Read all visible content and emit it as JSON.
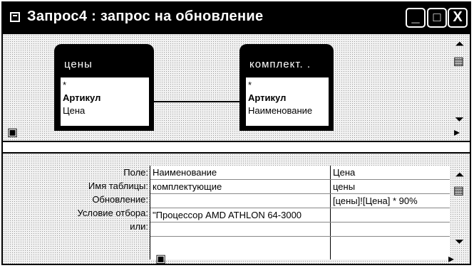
{
  "window": {
    "title": "Запрос4 : запрос на обновление",
    "controls": {
      "minimize": "_",
      "maximize": "□",
      "close": "X"
    }
  },
  "tables": [
    {
      "title": "цены",
      "fields": [
        "*",
        "Артикул",
        "Цена"
      ]
    },
    {
      "title": "комплект. .",
      "fields": [
        "*",
        "Артикул",
        "Наименование"
      ]
    }
  ],
  "grid": {
    "row_labels": [
      "Поле:",
      "Имя таблицы:",
      "Обновление:",
      "Условие отбора:",
      "или:"
    ],
    "columns": [
      {
        "field": "Наименование",
        "table": "комплектующие",
        "update": "",
        "criteria": "\"Процессор AMD ATHLON 64-3000",
        "or": ""
      },
      {
        "field": "Цена",
        "table": "цены",
        "update": "[цены]![Цена] * 90%",
        "criteria": "",
        "or": ""
      }
    ]
  },
  "icons": {
    "title": "query-icon",
    "scroll_up": "scroll-up-icon",
    "scroll_down": "scroll-down-icon",
    "view_toggle": "view-toggle-icon"
  }
}
